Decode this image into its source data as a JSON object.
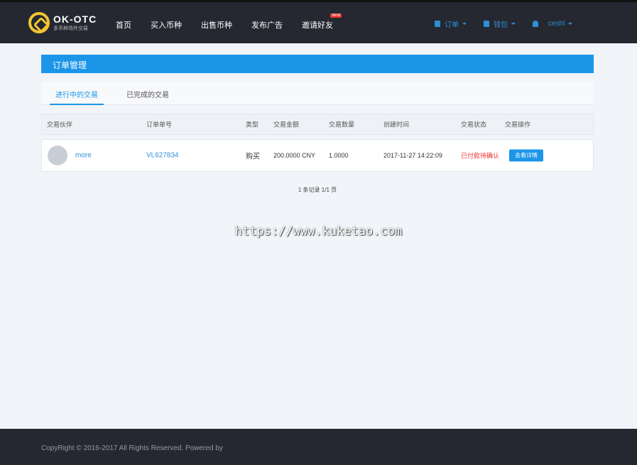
{
  "header": {
    "logo_title": "OK-OTC",
    "logo_subtitle": "多币种场外交易",
    "nav": [
      "首页",
      "买入币种",
      "出售币种",
      "发布广告",
      "邀请好友"
    ],
    "new_badge": "NEW",
    "orders": "订单",
    "wallet": "钱包",
    "user": "ceshl"
  },
  "page": {
    "title": "订单管理",
    "tabs": [
      "进行中的交易",
      "已完成的交易"
    ]
  },
  "table": {
    "headers": [
      "交易伙伴",
      "订单单号",
      "类型",
      "交易金额",
      "交易数量",
      "创建时间",
      "交易状态",
      "交易操作"
    ],
    "rows": [
      {
        "partner": "more",
        "order_no": "VL627834",
        "type": "购买",
        "amount": "200.0000 CNY",
        "quantity": "1.0000",
        "created": "2017-11-27 14:22:09",
        "status": "已付款待确认",
        "action": "去看详情"
      }
    ]
  },
  "pager": "1 条记录 1/1 页",
  "watermark": "https://www.kuketao.com",
  "footer": "CopyRight © 2016-2017 All Rights Reserved. Powered by"
}
